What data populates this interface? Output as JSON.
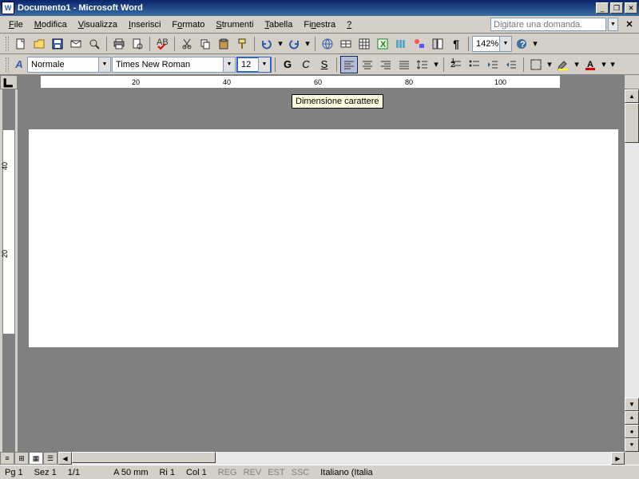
{
  "title": "Documento1 - Microsoft Word",
  "menu": [
    "File",
    "Modifica",
    "Visualizza",
    "Inserisci",
    "Formato",
    "Strumenti",
    "Tabella",
    "Finestra",
    "?"
  ],
  "ask_placeholder": "Digitare una domanda.",
  "zoom": "142%",
  "style": "Normale",
  "font": "Times New Roman",
  "fontsize": "12",
  "tooltip": "Dimensione carattere",
  "ruler_marks": [
    "20",
    "40",
    "60",
    "80",
    "100"
  ],
  "vruler_marks": [
    "40",
    "20"
  ],
  "fmt": {
    "bold": "G",
    "italic": "C",
    "underline": "S"
  },
  "status": {
    "page": "Pg 1",
    "section": "Sez 1",
    "pages": "1/1",
    "at": "A 50 mm",
    "line": "Ri 1",
    "col": "Col 1",
    "modes": [
      "REG",
      "REV",
      "EST",
      "SSC"
    ],
    "lang": "Italiano (Italia"
  }
}
